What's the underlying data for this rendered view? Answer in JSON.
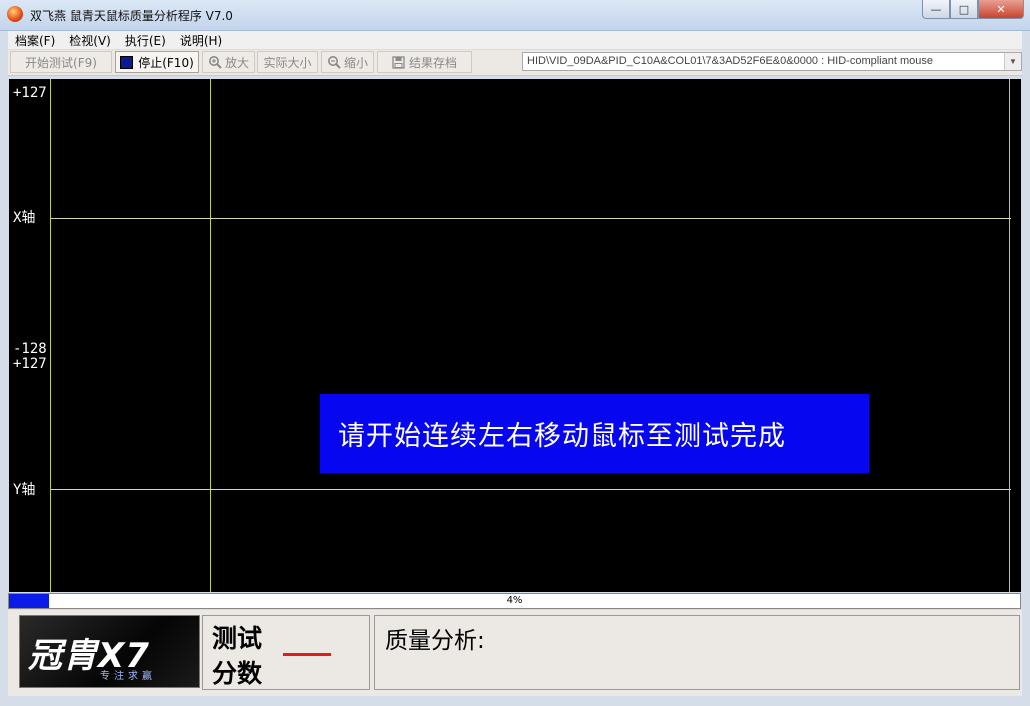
{
  "window": {
    "title": "双飞燕 鼠青天鼠标质量分析程序 V7.0",
    "min_glyph": "—",
    "max_glyph": "□",
    "close_glyph": "✕"
  },
  "menu": [
    "档案(F)",
    "检视(V)",
    "执行(E)",
    "说明(H)"
  ],
  "toolbar": {
    "start_label": "开始测试(F9)",
    "stop_label": "停止(F10)",
    "zoom_in_label": "放大",
    "actual_size_label": "实际大小",
    "zoom_out_label": "缩小",
    "save_label": "结果存档"
  },
  "device": {
    "selected": "HID\\VID_09DA&PID_C10A&COL01\\7&3AD52F6E&0&0000  :  HID-compliant mouse"
  },
  "plot": {
    "x_top": "+127",
    "x_axis": "X轴",
    "x_bottom": "-128",
    "y_top": "+127",
    "y_axis": "Y轴",
    "message": "请开始连续左右移动鼠标至测试完成"
  },
  "progress": {
    "percent": 4,
    "text": "4%"
  },
  "logo": {
    "brand": "冠胄X7",
    "slogan": "专注求赢"
  },
  "score": {
    "line1": "测试",
    "line2": "分数"
  },
  "analysis": {
    "label": "质量分析:"
  },
  "colors": {
    "plot_bg": "#000000",
    "message_bg": "#0606f0",
    "progress_fill": "#0a1de8",
    "score_dash": "#e51a1a",
    "grid": "#c9c94a"
  }
}
